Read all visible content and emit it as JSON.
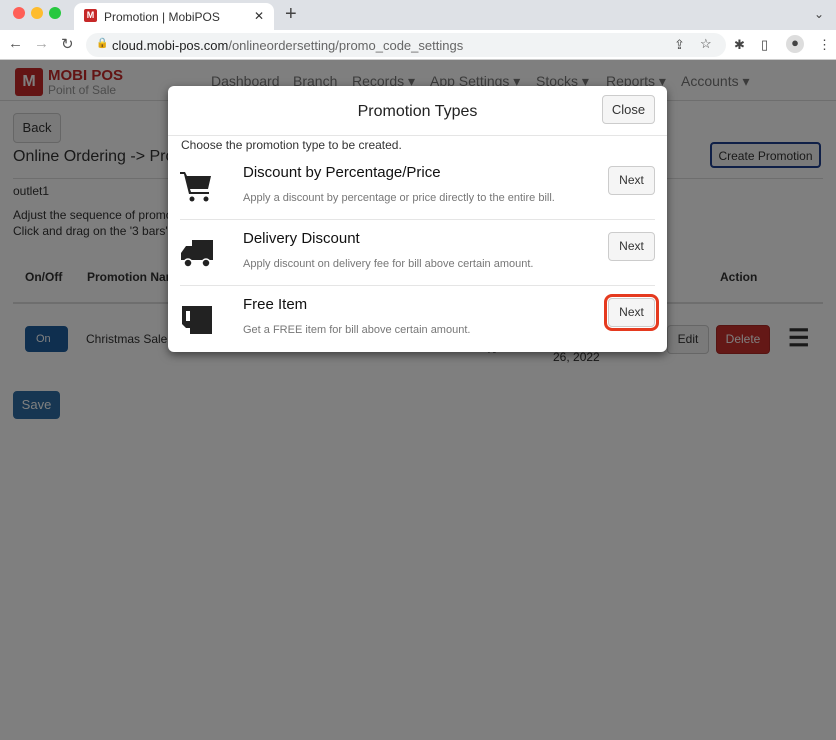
{
  "browser": {
    "tab_title": "Promotion | MobiPOS",
    "url_host": "cloud.mobi-pos.com",
    "url_path": "/onlineordersetting/promo_code_settings"
  },
  "app": {
    "brand": "MOBI POS",
    "brand_sub": "Point of Sale",
    "menu": [
      "Dashboard",
      "Branch",
      "Records ▾",
      "App Settings ▾",
      "Stocks ▾",
      "Reports ▾",
      "Accounts ▾"
    ],
    "back": "Back",
    "breadcrumb": "Online Ordering -> Prom",
    "create": "Create Promotion",
    "outlet": "outlet1",
    "instr1": "Adjust the sequence of promo",
    "instr2": "Click and drag on the '3 bars'",
    "col_onoff": "On/Off",
    "col_name": "Promotion Nar",
    "col_action": "Action",
    "row": {
      "toggle": "On",
      "name": "Christmas Sale",
      "value": "%",
      "date": "26, 2022",
      "edit": "Edit",
      "delete": "Delete"
    },
    "save": "Save"
  },
  "modal": {
    "title": "Promotion Types",
    "close": "Close",
    "intro": "Choose the promotion type to be created.",
    "types": [
      {
        "icon": "cart-icon",
        "title": "Discount by Percentage/Price",
        "desc": "Apply a discount by percentage or price directly to the entire bill.",
        "button": "Next"
      },
      {
        "icon": "truck-icon",
        "title": "Delivery Discount",
        "desc": "Apply discount on delivery fee for bill above certain amount.",
        "button": "Next"
      },
      {
        "icon": "mug-icon",
        "title": "Free Item",
        "desc": "Get a FREE item for bill above certain amount.",
        "button": "Next"
      }
    ]
  },
  "colors": {
    "highlight": "#e53a1f",
    "primary": "#1f5f9e",
    "danger": "#b52b27"
  }
}
